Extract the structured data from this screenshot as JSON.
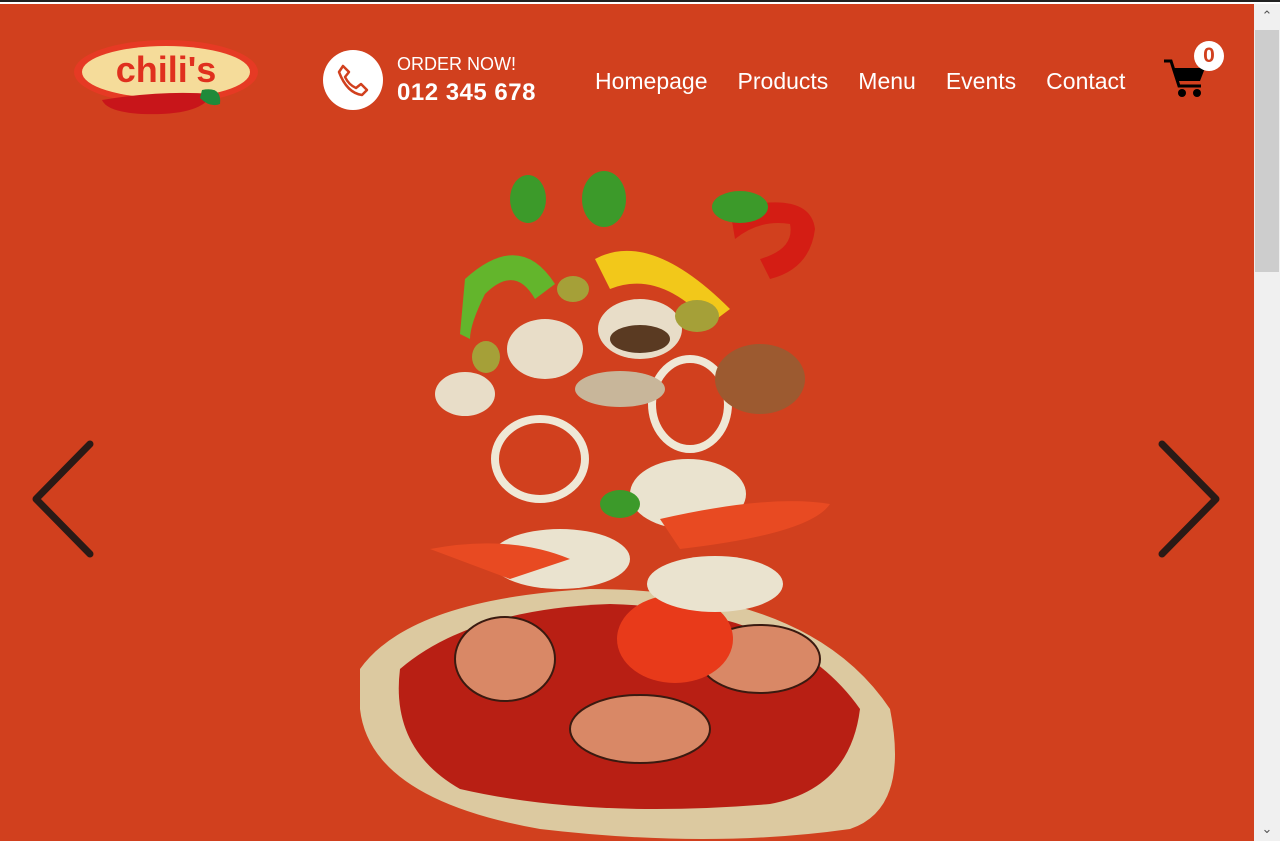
{
  "brand": {
    "name": "chili's"
  },
  "order": {
    "label": "ORDER NOW!",
    "phone": "012 345 678"
  },
  "nav": [
    {
      "label": "Homepage"
    },
    {
      "label": "Products"
    },
    {
      "label": "Menu"
    },
    {
      "label": "Events"
    },
    {
      "label": "Contact"
    }
  ],
  "cart": {
    "count": "0"
  },
  "colors": {
    "background": "#D1401E",
    "text": "#FFFFFF",
    "arrow": "#2a1a16"
  }
}
